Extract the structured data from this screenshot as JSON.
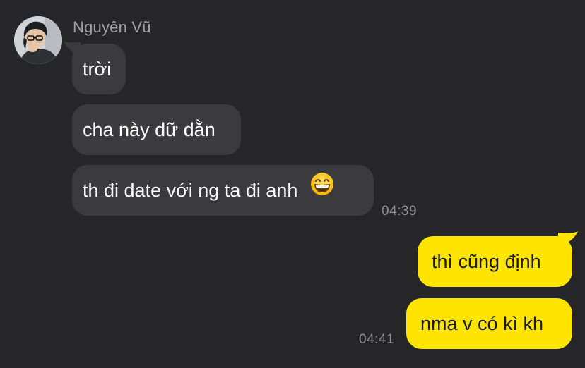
{
  "sender": {
    "name": "Nguyên Vũ"
  },
  "messages": {
    "incoming": [
      {
        "text": "trời"
      },
      {
        "text": "cha này dữ dằn"
      },
      {
        "text": "th đi date với ng ta đi anh",
        "emoji": "grinning-face-with-smiling-eyes-emoji"
      }
    ],
    "incoming_time": "04:39",
    "outgoing": [
      {
        "text": "thì cũng định"
      },
      {
        "text": "nma v có kì kh"
      }
    ],
    "outgoing_time": "04:41"
  },
  "colors": {
    "background": "#262628",
    "incoming_bubble": "#3b3b3e",
    "outgoing_bubble": "#fde500",
    "timestamp": "#8e8e93",
    "sender_name": "#a0a0a5"
  }
}
